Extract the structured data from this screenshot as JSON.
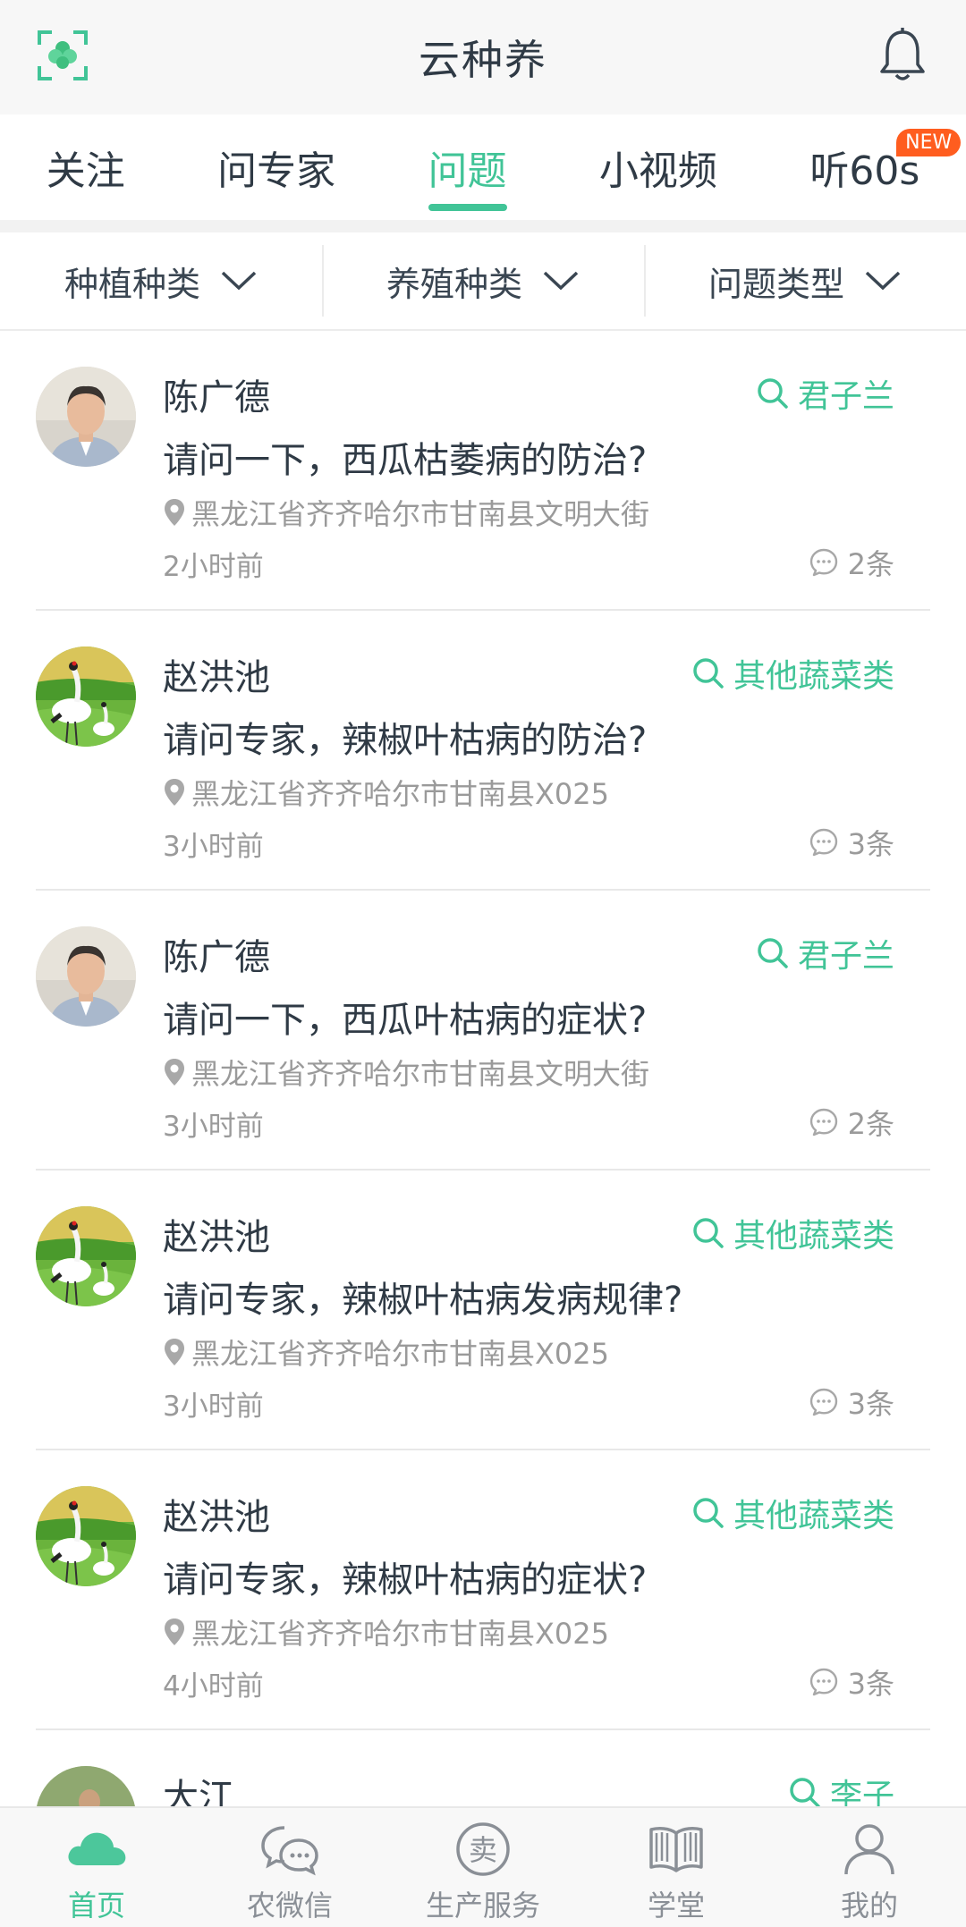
{
  "header": {
    "title": "云种养",
    "scan_icon": "scan-logo-icon",
    "bell_icon": "bell-icon"
  },
  "tabs": [
    {
      "label": "关注",
      "active": false
    },
    {
      "label": "问专家",
      "active": false
    },
    {
      "label": "问题",
      "active": true
    },
    {
      "label": "小视频",
      "active": false
    },
    {
      "label": "听60s",
      "active": false,
      "badge": "NEW"
    }
  ],
  "filters": [
    {
      "label": "种植种类"
    },
    {
      "label": "养殖种类"
    },
    {
      "label": "问题类型"
    }
  ],
  "questions": [
    {
      "name": "陈广德",
      "tag": "君子兰",
      "question": "请问一下，西瓜枯萎病的防治?",
      "location": "黑龙江省齐齐哈尔市甘南县文明大街",
      "time": "2小时前",
      "count": "2条"
    },
    {
      "name": "赵洪池",
      "tag": "其他蔬菜类",
      "question": "请问专家，辣椒叶枯病的防治?",
      "location": "黑龙江省齐齐哈尔市甘南县X025",
      "time": "3小时前",
      "count": "3条"
    },
    {
      "name": "陈广德",
      "tag": "君子兰",
      "question": "请问一下，西瓜叶枯病的症状?",
      "location": "黑龙江省齐齐哈尔市甘南县文明大街",
      "time": "3小时前",
      "count": "2条"
    },
    {
      "name": "赵洪池",
      "tag": "其他蔬菜类",
      "question": "请问专家，辣椒叶枯病发病规律?",
      "location": "黑龙江省齐齐哈尔市甘南县X025",
      "time": "3小时前",
      "count": "3条"
    },
    {
      "name": "赵洪池",
      "tag": "其他蔬菜类",
      "question": "请问专家，辣椒叶枯病的症状?",
      "location": "黑龙江省齐齐哈尔市甘南县X025",
      "time": "4小时前",
      "count": "3条"
    },
    {
      "name": "大江",
      "tag": "李子"
    }
  ],
  "bottom_nav": [
    {
      "label": "首页",
      "icon": "cloud-home-icon",
      "active": true
    },
    {
      "label": "农微信",
      "icon": "chat-bubbles-icon",
      "active": false
    },
    {
      "label": "生产服务",
      "icon": "sell-circle-icon",
      "active": false,
      "glyph": "卖"
    },
    {
      "label": "学堂",
      "icon": "book-icon",
      "active": false
    },
    {
      "label": "我的",
      "icon": "person-icon",
      "active": false
    }
  ],
  "colors": {
    "accent": "#41c497",
    "badge": "#ff5d1f",
    "text": "#2f3a45",
    "muted": "#9a9a9a"
  }
}
